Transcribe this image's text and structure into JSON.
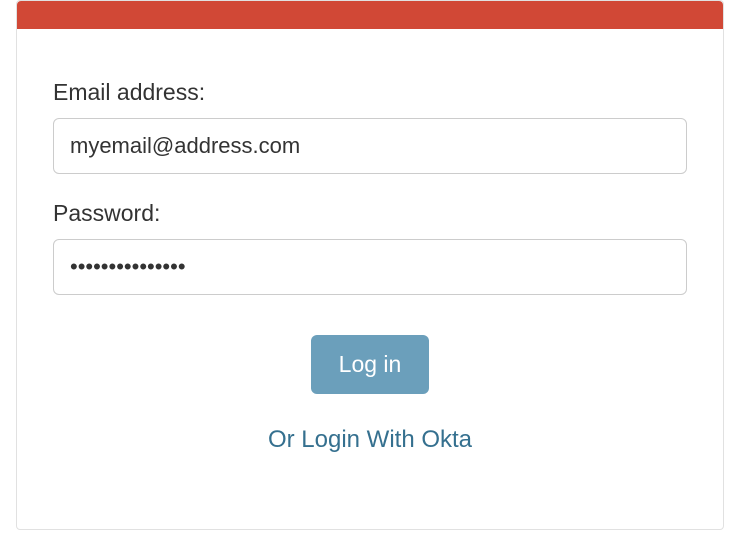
{
  "form": {
    "email": {
      "label": "Email address:",
      "value": "myemail@address.com"
    },
    "password": {
      "label": "Password:",
      "value": "•••••••••••••••"
    },
    "login_button": "Log in",
    "okta_link": "Or Login With Okta"
  }
}
